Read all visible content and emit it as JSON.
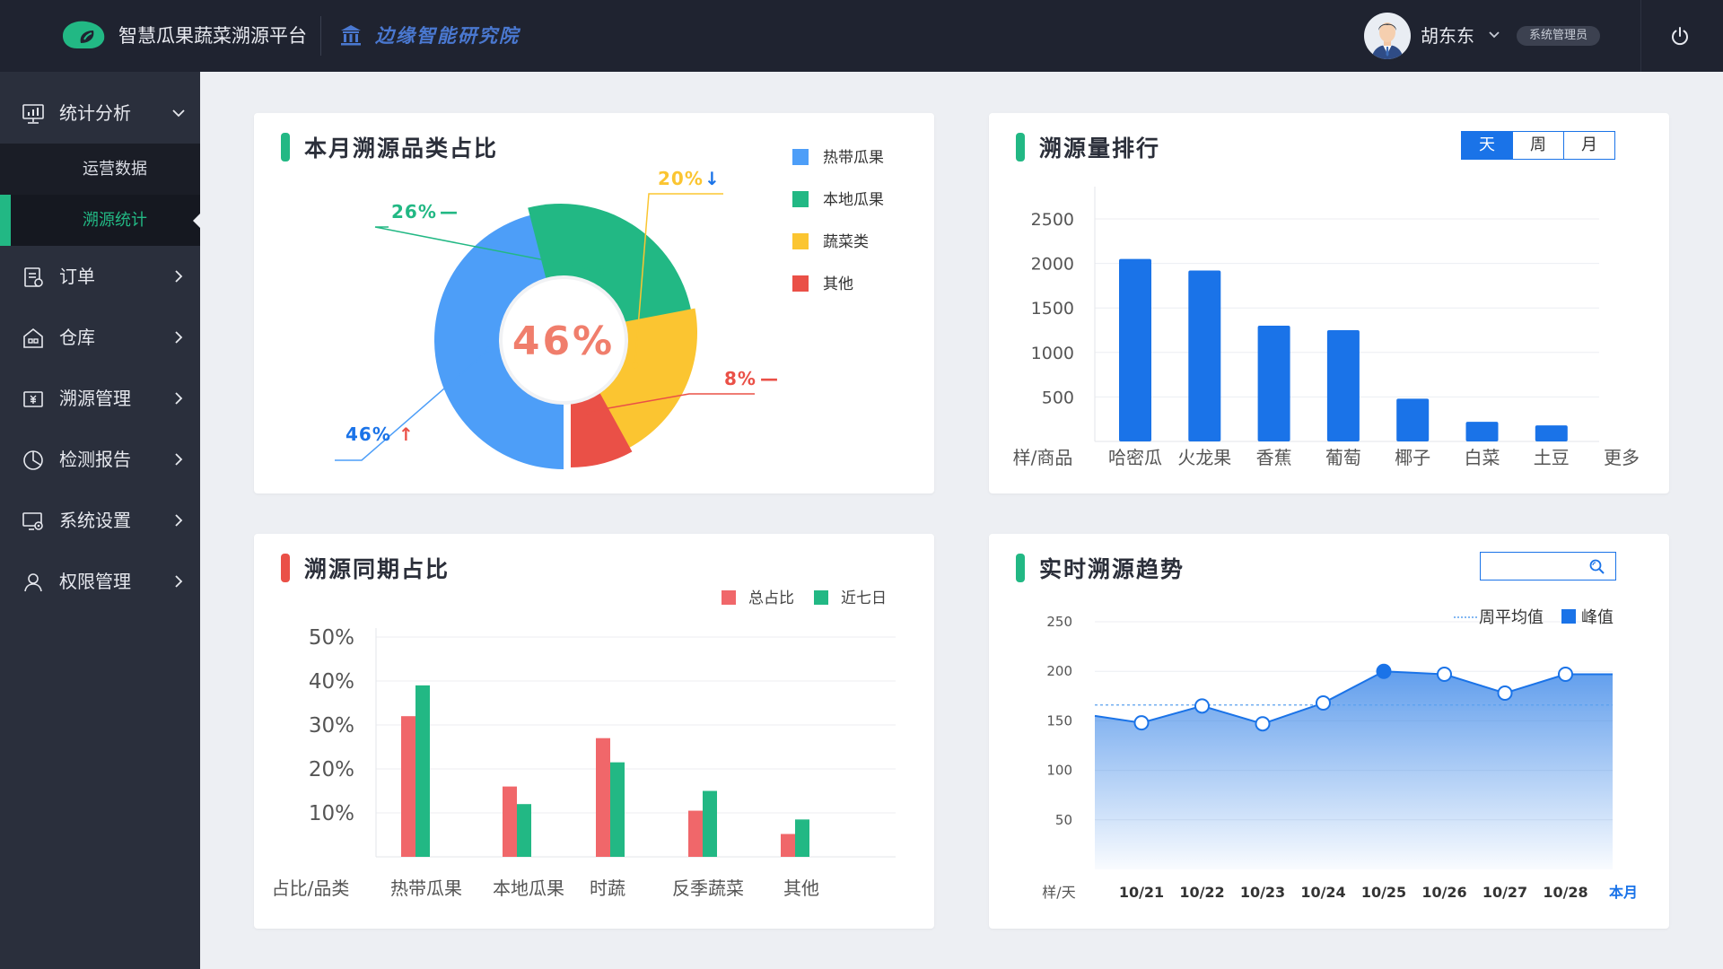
{
  "app": {
    "title": "智慧瓜果蔬菜溯源平台",
    "org": "边缘智能研究院"
  },
  "user": {
    "name": "胡东东",
    "role": "系统管理员"
  },
  "colors": {
    "green": "#22b884",
    "blue": "#1a73e8",
    "yellow": "#fbc531",
    "red": "#ea5047",
    "lightblue": "#4d9ef8"
  },
  "sidebar": {
    "items": [
      {
        "label": "统计分析",
        "icon": "analytics-icon",
        "expanded": true
      },
      {
        "label": "订单",
        "icon": "order-icon"
      },
      {
        "label": "仓库",
        "icon": "warehouse-icon"
      },
      {
        "label": "溯源管理",
        "icon": "trace-icon"
      },
      {
        "label": "检测报告",
        "icon": "report-icon"
      },
      {
        "label": "系统设置",
        "icon": "settings-icon"
      },
      {
        "label": "权限管理",
        "icon": "user-icon"
      }
    ],
    "sub_items": [
      {
        "label": "运营数据",
        "active": false
      },
      {
        "label": "溯源统计",
        "active": true
      }
    ]
  },
  "cards": {
    "category_share": {
      "title": "本月溯源品类占比",
      "center_label": "46%",
      "chart_data": {
        "type": "pie",
        "donut": true,
        "categories": [
          "热带瓜果",
          "本地瓜果",
          "蔬菜类",
          "其他"
        ],
        "values": [
          46,
          26,
          20,
          8
        ],
        "colors": [
          "#4d9ef8",
          "#22b884",
          "#fbc531",
          "#ea5047"
        ],
        "callouts": [
          {
            "category": "热带瓜果",
            "text": "46%",
            "trend": "↑"
          },
          {
            "category": "本地瓜果",
            "text": "26%",
            "trend": "—"
          },
          {
            "category": "蔬菜类",
            "text": "20%",
            "trend": "↓"
          },
          {
            "category": "其他",
            "text": "8%",
            "trend": "—"
          }
        ],
        "legend_position": "right"
      }
    },
    "ranking": {
      "title": "溯源量排行",
      "tabs": [
        {
          "label": "天",
          "active": true
        },
        {
          "label": "周",
          "active": false
        },
        {
          "label": "月",
          "active": false
        }
      ],
      "chart_data": {
        "type": "bar",
        "categories": [
          "哈密瓜",
          "火龙果",
          "香蕉",
          "葡萄",
          "椰子",
          "白菜",
          "土豆"
        ],
        "values": [
          2050,
          1920,
          1300,
          1250,
          480,
          220,
          180
        ],
        "yticks": [
          500,
          1000,
          1500,
          2000,
          2500
        ],
        "ylim": [
          0,
          2500
        ],
        "ylabel": "样/商品",
        "more_label": "更多",
        "color": "#1a73e8",
        "grid": true
      }
    },
    "period_share": {
      "title": "溯源同期占比",
      "chart_data": {
        "type": "bar",
        "categories": [
          "热带瓜果",
          "本地瓜果",
          "时蔬",
          "反季蔬菜",
          "其他"
        ],
        "series": [
          {
            "name": "总占比",
            "values": [
              32,
              16,
              27,
              10.5,
              5.2
            ],
            "color": "#f0676a"
          },
          {
            "name": "近七日",
            "values": [
              39,
              12,
              21.5,
              15,
              8.5
            ],
            "color": "#22b884"
          }
        ],
        "yticks": [
          "10%",
          "20%",
          "30%",
          "40%",
          "50%"
        ],
        "ylim": [
          0,
          50
        ],
        "xlabel": "占比/品类",
        "legend_position": "top-right",
        "grid": true
      }
    },
    "trend": {
      "title": "实时溯源趋势",
      "search_placeholder": "",
      "chart_data": {
        "type": "area",
        "x": [
          "10/21",
          "10/22",
          "10/23",
          "10/24",
          "10/25",
          "10/26",
          "10/27",
          "10/28"
        ],
        "values": [
          148,
          165,
          147,
          168,
          200,
          197,
          178,
          197
        ],
        "start_value": 155,
        "end_value": 197,
        "peak_index": 4,
        "average": 166,
        "yticks": [
          50,
          100,
          150,
          200,
          250
        ],
        "ylim": [
          0,
          250
        ],
        "ylabel": "样/天",
        "x_extra_label": "本月",
        "legend": [
          {
            "name": "周平均值",
            "style": "dotted"
          },
          {
            "name": "峰值",
            "style": "square"
          }
        ],
        "grid": true
      }
    }
  }
}
